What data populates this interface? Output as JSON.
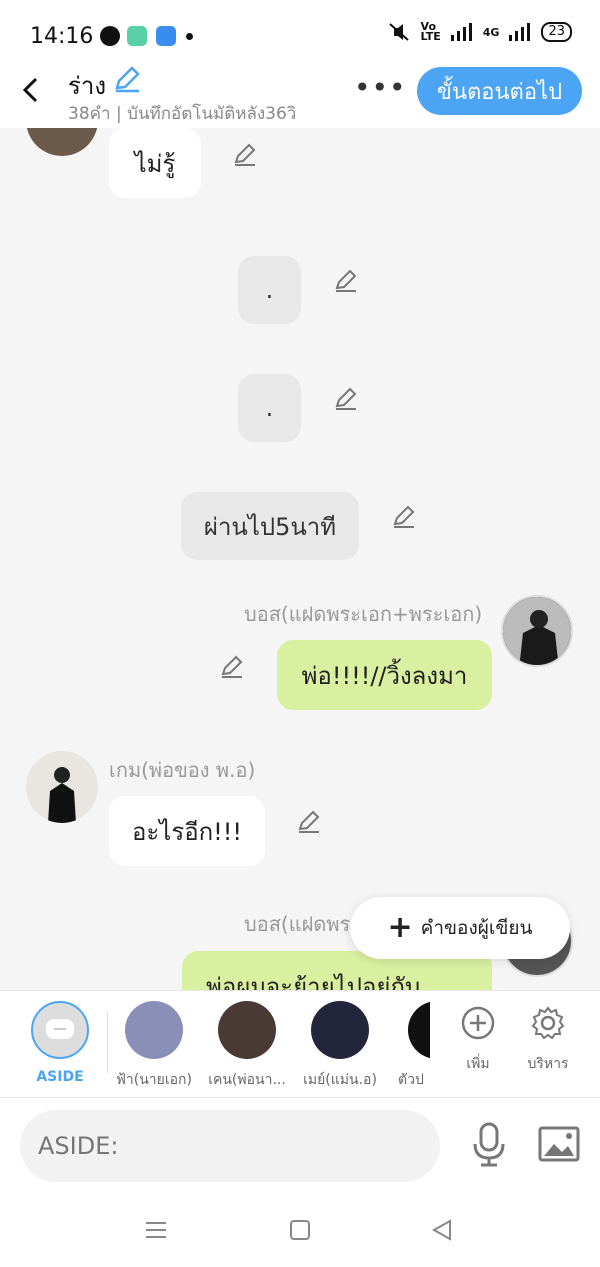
{
  "status_bar": {
    "time": "14:16",
    "battery": "23",
    "network": "4G"
  },
  "header": {
    "title": "ร่าง",
    "meta": "38คำ | บันทึกอัตโนมัติหลัง36วิ",
    "more": "•••",
    "next_button": "ขั้นตอนต่อไป"
  },
  "messages": [
    {
      "type": "left",
      "text": "ไม่รู้"
    },
    {
      "type": "aside",
      "text": "."
    },
    {
      "type": "aside",
      "text": "."
    },
    {
      "type": "aside",
      "text": "ผ่านไป5นาที"
    },
    {
      "type": "right",
      "sender": "บอส(แฝดพระเอก+พระเอก)",
      "text": "พ่อ!!!!//วิ้งลงมา"
    },
    {
      "type": "left",
      "sender": "เกม(พ่อของ พ.อ)",
      "text": "อะไรอีก!!!"
    },
    {
      "type": "right",
      "sender": "บอส(แฝดพระเอก+พระเอก)",
      "text": "พ่อผมจะย้ายไปอยู่กับ"
    }
  ],
  "fab": {
    "label": "คำของผู้เขียน"
  },
  "characters": [
    {
      "name": "ASIDE"
    },
    {
      "name": "ฟ้า(นายเอก)"
    },
    {
      "name": "เคน(พ่อนา..."
    },
    {
      "name": "เมย์(แม่น.อ)"
    },
    {
      "name": "ตัวป"
    }
  ],
  "tools": {
    "add": "เพิ่ม",
    "manage": "บริหาร"
  },
  "input": {
    "placeholder": "ASIDE:"
  },
  "colors": {
    "accent": "#4ca4f5",
    "green_bubble": "#d8f0a0",
    "grey_bubble": "#e8e8e8"
  },
  "icons": [
    "back-icon",
    "pencil-icon",
    "more-icon",
    "plus-icon",
    "aside-icon",
    "add-circle-icon",
    "gear-icon",
    "mic-icon",
    "image-icon",
    "menu-icon",
    "home-icon",
    "nav-back-icon"
  ]
}
